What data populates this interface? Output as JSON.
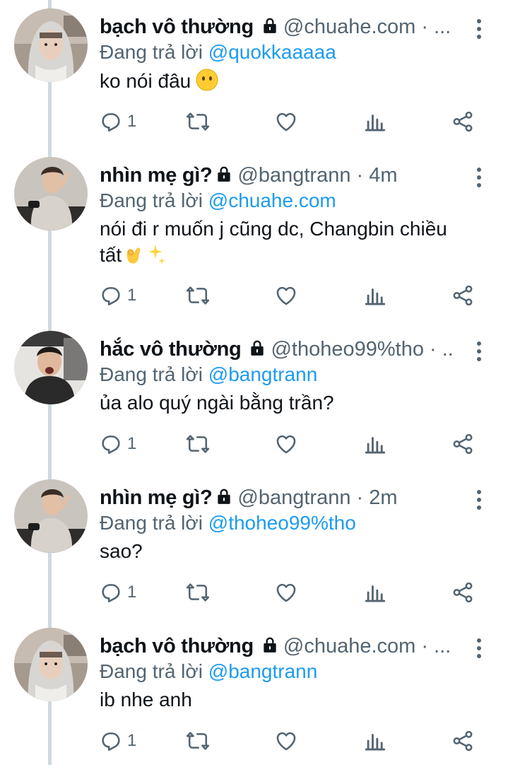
{
  "colors": {
    "text": "#0f1419",
    "secondary": "#536471",
    "accent": "#1d9bf0",
    "thread": "#cfd9de"
  },
  "reply_prefix": "Đang trả lời",
  "tweets": [
    {
      "name": "bạch vô thường",
      "meta": "@chuahe.com · ...",
      "mention": "@quokkaaaaa",
      "text": "ko nói đâu",
      "emoji": "neutral-face",
      "replies": "1",
      "avatar": "hooded-person"
    },
    {
      "name": "nhìn mẹ gì?",
      "meta": "@bangtrann · 4m",
      "mention": "@chuahe.com",
      "text_line1": "nói đi r muốn j cũng dc, Changbin chiều",
      "text_line2": "tất",
      "emoji": "ok-hand-sparkles",
      "replies": "1",
      "avatar": "person-sitting"
    },
    {
      "name": "hắc vô thường",
      "meta": "@thoheo99%tho · ...",
      "mention": "@bangtrann",
      "text": "ủa alo quý ngài bằng trần?",
      "replies": "1",
      "avatar": "person-shouting"
    },
    {
      "name": "nhìn mẹ gì?",
      "meta": "@bangtrann · 2m",
      "mention": "@thoheo99%tho",
      "text": "sao?",
      "replies": "1",
      "avatar": "person-sitting"
    },
    {
      "name": "bạch vô thường",
      "meta": "@chuahe.com · ...",
      "mention": "@bangtrann",
      "text": "ib nhe anh",
      "replies": "1",
      "avatar": "hooded-person"
    }
  ],
  "icons": [
    "reply-icon",
    "retweet-icon",
    "like-icon",
    "analytics-icon",
    "share-icon",
    "more-icon",
    "lock-icon"
  ]
}
